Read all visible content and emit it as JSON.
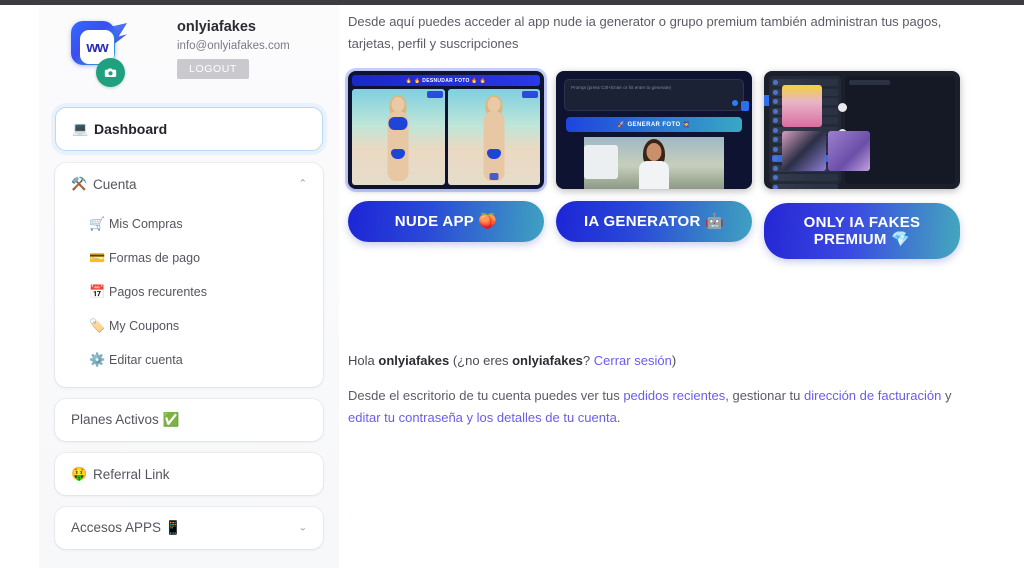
{
  "profile": {
    "name": "onlyiafakes",
    "email": "info@onlyiafakes.com",
    "logout_label": "LOGOUT",
    "logo_glyph": "ww",
    "camera_icon": "◉"
  },
  "sidebar": {
    "dashboard": {
      "label": "Dashboard",
      "icon": "💻"
    },
    "account": {
      "label": "Cuenta",
      "icon": "⚒️",
      "chevron": "⌃",
      "items": [
        {
          "label": "Mis Compras",
          "icon": "🛒"
        },
        {
          "label": "Formas de pago",
          "icon": "💳"
        },
        {
          "label": "Pagos recurentes",
          "icon": "📅"
        },
        {
          "label": "My Coupons",
          "icon": "🏷️"
        },
        {
          "label": "Editar cuenta",
          "icon": "⚙️"
        }
      ]
    },
    "planes": {
      "label": "Planes Activos ✅"
    },
    "referral": {
      "label": "Referral Link",
      "icon": "🤑"
    },
    "accesos": {
      "label": "Accesos APPS 📱",
      "chevron": "⌄"
    }
  },
  "main": {
    "intro": "Desde aquí puedes acceder al app nude ia generator o grupo premium también administran tus pagos, tarjetas, perfil y suscripciones",
    "promos": [
      {
        "button": "NUDE APP 🍑",
        "shot_title": "🔥 🔥 DESNUDAR FOTO 🔥 🔥"
      },
      {
        "button": "IA GENERATOR 🤖",
        "shot_button": "🚀 GENERAR FOTO 👮",
        "shot_placeholder": "Prompt (press Ctrl+Enter or hit enter to generate)"
      },
      {
        "button_line1": "ONLY IA FAKES",
        "button_line2": "PREMIUM 💎"
      }
    ],
    "greeting": {
      "hello": "Hola",
      "user": "onlyiafakes",
      "not_you_open": "(¿no eres",
      "user2": "onlyiafakes",
      "q": "?",
      "logout_link": "Cerrar sesión",
      "close_paren": ")"
    },
    "desc": {
      "p1": "Desde el escritorio de tu cuenta puedes ver tus ",
      "link1": "pedidos recientes",
      "p2": ", gestionar tu ",
      "link2": "dirección de facturación",
      "p3": " y ",
      "link3": "editar tu contraseña y los detalles de tu cuenta",
      "p4": "."
    }
  },
  "colors": {
    "accent": "#6a5cf0",
    "cta_start": "#1d25d6",
    "cta_end": "#3fa2c0",
    "badge_green": "#1fa07e",
    "topbar": "#3c3c42"
  }
}
